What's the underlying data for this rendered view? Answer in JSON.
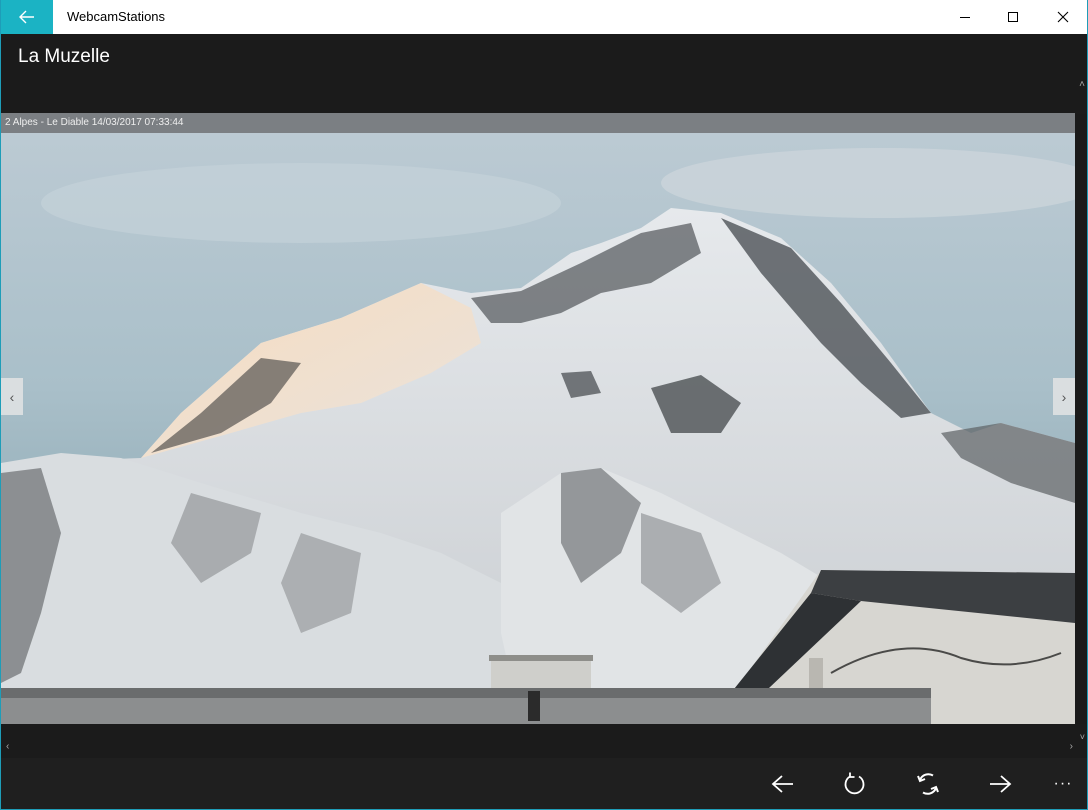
{
  "window": {
    "app_title": "WebcamStations"
  },
  "header": {
    "title": "La Muzelle"
  },
  "viewer": {
    "caption": "2 Alpes - Le Diable 14/03/2017 07:33:44"
  },
  "nav": {
    "prev_glyph": "‹",
    "next_glyph": "›"
  },
  "scroll": {
    "up": "˄",
    "down": "˅",
    "left": "‹",
    "right": "›"
  },
  "commandbar": {
    "icons": [
      "arrow-left-icon",
      "refresh-icon",
      "sync-icon",
      "arrow-right-icon"
    ],
    "more_label": "···"
  },
  "colors": {
    "accent": "#1bb3c4",
    "chrome_dark": "#1b1b1b"
  }
}
